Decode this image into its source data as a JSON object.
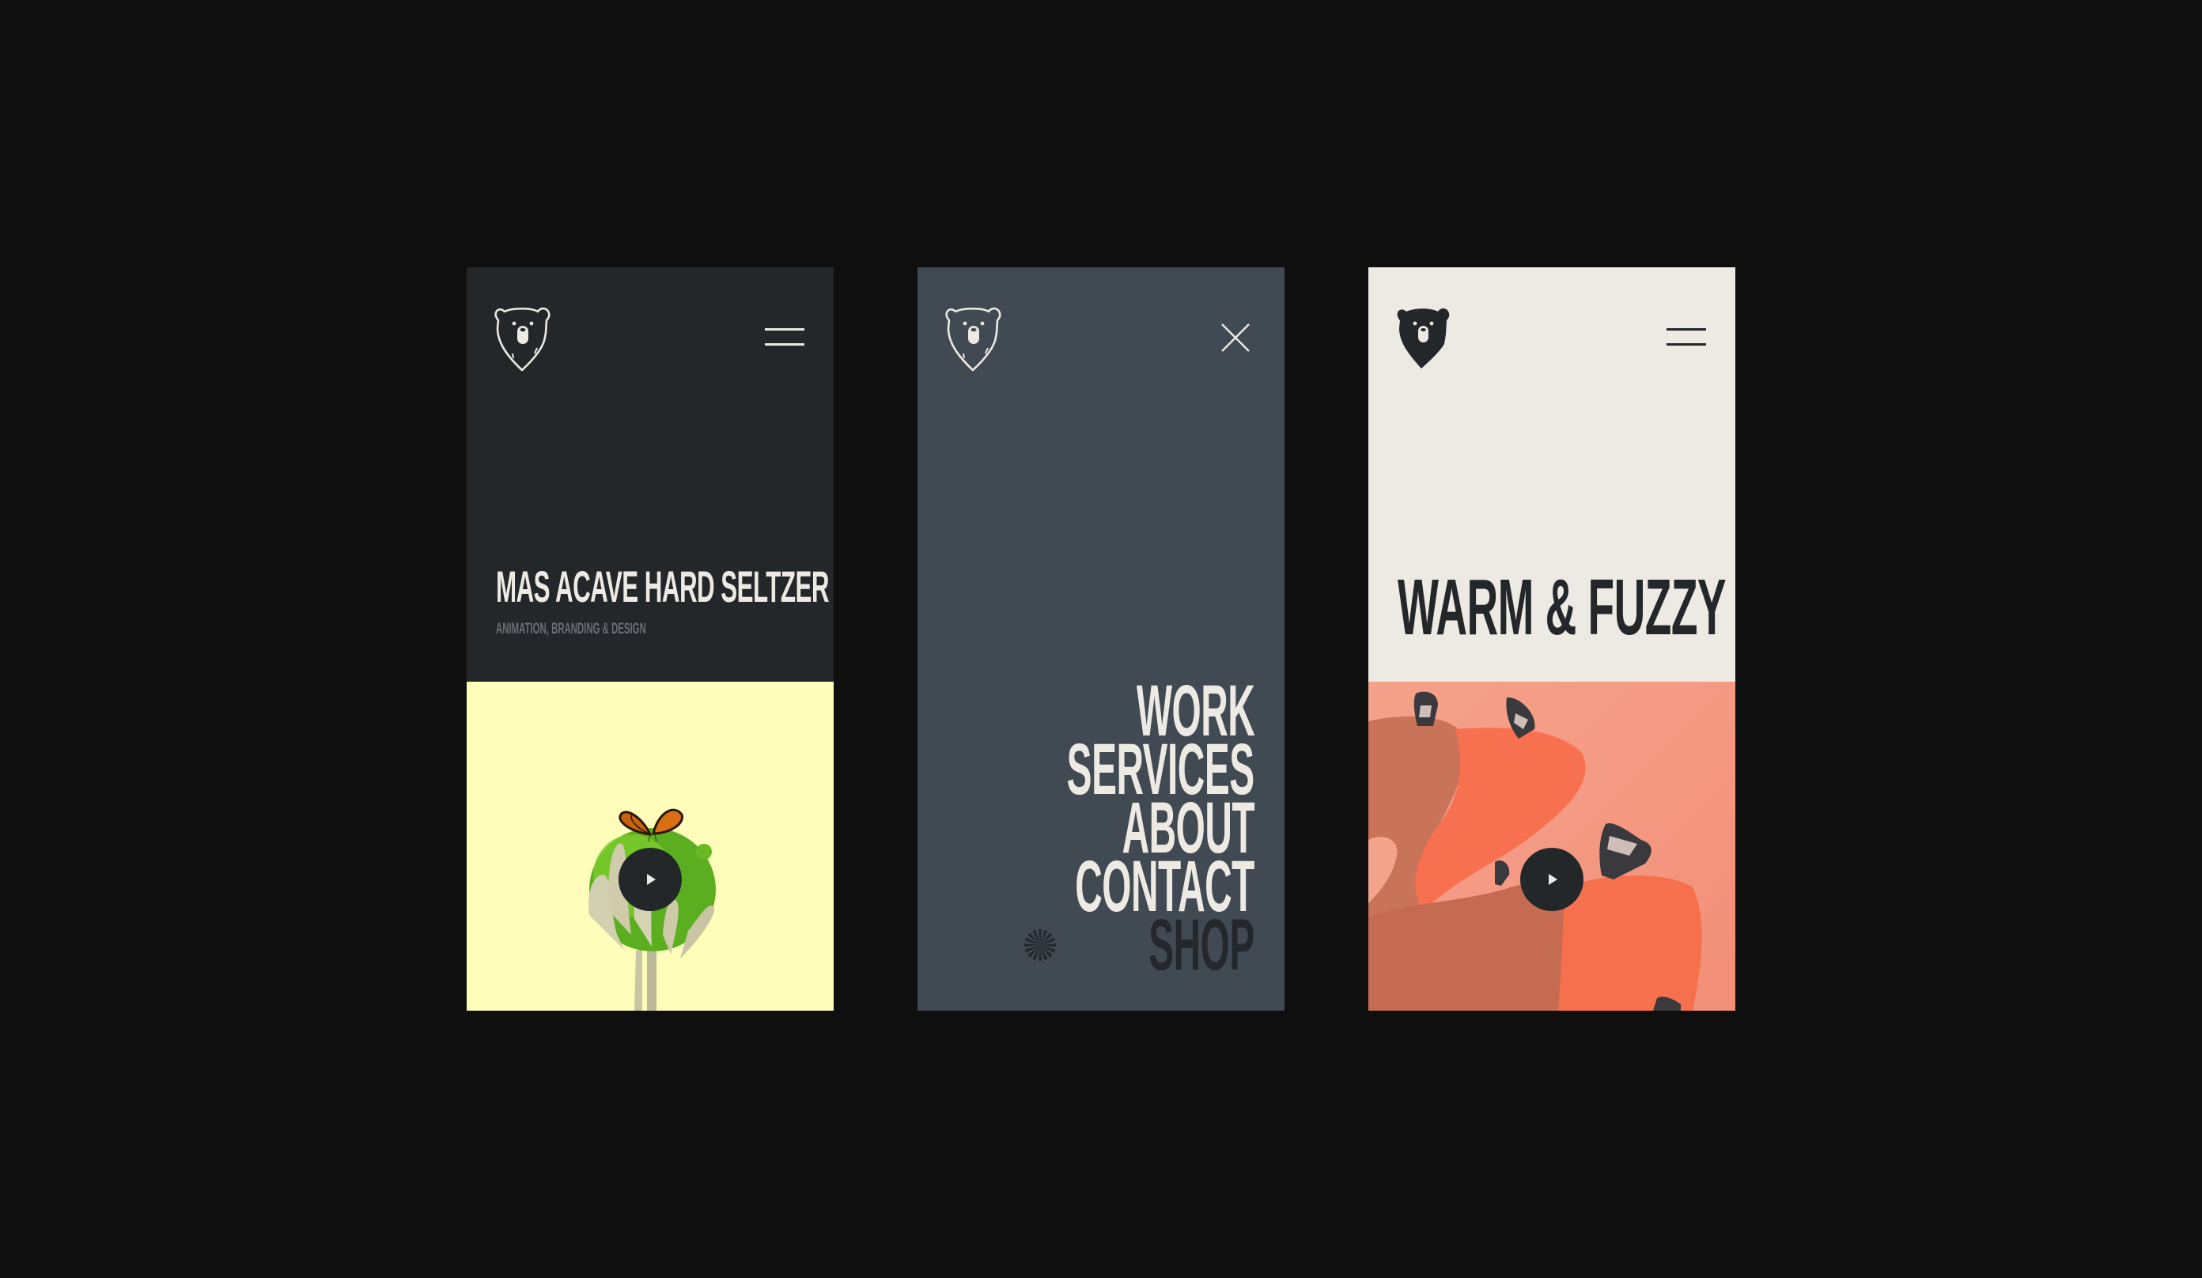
{
  "brand": {
    "logo_icon": "bear-head-icon",
    "colors": {
      "page_background": "#0f0f0f",
      "charcoal": "#23272a",
      "slate": "#414953",
      "cream": "#edeae3",
      "pale_yellow": "#fefdb9",
      "coral": "#f59b85",
      "muted_gray": "#6b6e72"
    }
  },
  "panels": [
    {
      "id": "project-page",
      "menu_icon": "hamburger-menu-icon",
      "title": "MAS ACAVE HARD SELTZER",
      "subtitle": "ANIMATION, BRANDING & DESIGN",
      "media": {
        "description": "Skeleton hand holding a lime with a monarch butterfly on top",
        "play_icon": "play-icon"
      }
    },
    {
      "id": "menu-open",
      "menu_icon": "close-icon",
      "nav": [
        {
          "label": "WORK"
        },
        {
          "label": "SERVICES"
        },
        {
          "label": "ABOUT"
        },
        {
          "label": "CONTACT"
        },
        {
          "label": "SHOP",
          "icon": "starburst-icon"
        }
      ]
    },
    {
      "id": "project-page-light",
      "menu_icon": "hamburger-menu-icon",
      "title": "WARM & FUZZY",
      "media": {
        "description": "Sneakers on undulating coral 3D shapes",
        "play_icon": "play-icon"
      }
    }
  ]
}
